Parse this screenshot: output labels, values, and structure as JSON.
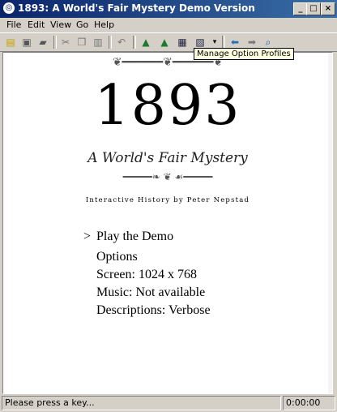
{
  "window": {
    "title": "1893: A World's Fair Mystery Demo Version"
  },
  "menu": [
    "File",
    "Edit",
    "View",
    "Go",
    "Help"
  ],
  "toolbar": {
    "tooltip": "Manage Option Profiles"
  },
  "game": {
    "title": "1893",
    "subtitle": "A World's Fair Mystery",
    "credit": "Interactive History by Peter Nepstad",
    "cursor": ">",
    "options": [
      "Play the Demo",
      "Options",
      "Screen: 1024 x 768",
      "Music: Not available",
      "Descriptions: Verbose"
    ]
  },
  "status": {
    "message": "Please press a key...",
    "time": "0:00:00"
  }
}
